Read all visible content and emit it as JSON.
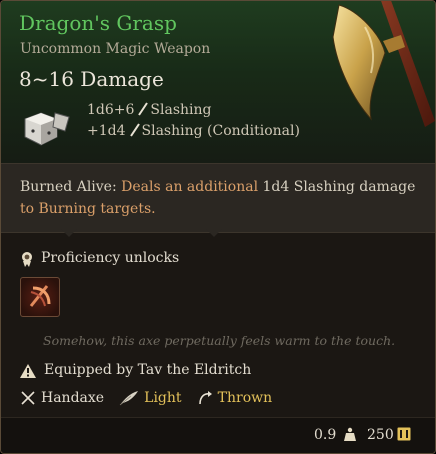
{
  "item": {
    "name": "Dragon's Grasp",
    "rarity_type": "Uncommon Magic Weapon",
    "damage_summary": "8~16 Damage",
    "damage_lines": [
      {
        "dice": "1d6+6",
        "type": "Slashing"
      },
      {
        "dice": "+1d4",
        "type": "Slashing (Conditional)"
      }
    ],
    "passive": {
      "name": "Burned Alive:",
      "text_a": "Deals an additional",
      "dice": "1d4 Slashing damage",
      "text_b": "to Burning targets."
    },
    "proficiency_label": "Proficiency unlocks",
    "flavor_text": "Somehow, this axe perpetually feels warm to the touch.",
    "equipped_by": "Equipped by Tav the Eldritch",
    "properties": [
      {
        "label": "Handaxe",
        "icon": "crossed-axes-icon"
      },
      {
        "label": "Light",
        "icon": "feather-icon"
      },
      {
        "label": "Thrown",
        "icon": "thrown-icon"
      }
    ],
    "weight": "0.9",
    "price": "250"
  },
  "colors": {
    "name": "#61c65f",
    "accent": "#dba06a",
    "property_gold": "#e3c15a",
    "background": "#1b1713"
  }
}
